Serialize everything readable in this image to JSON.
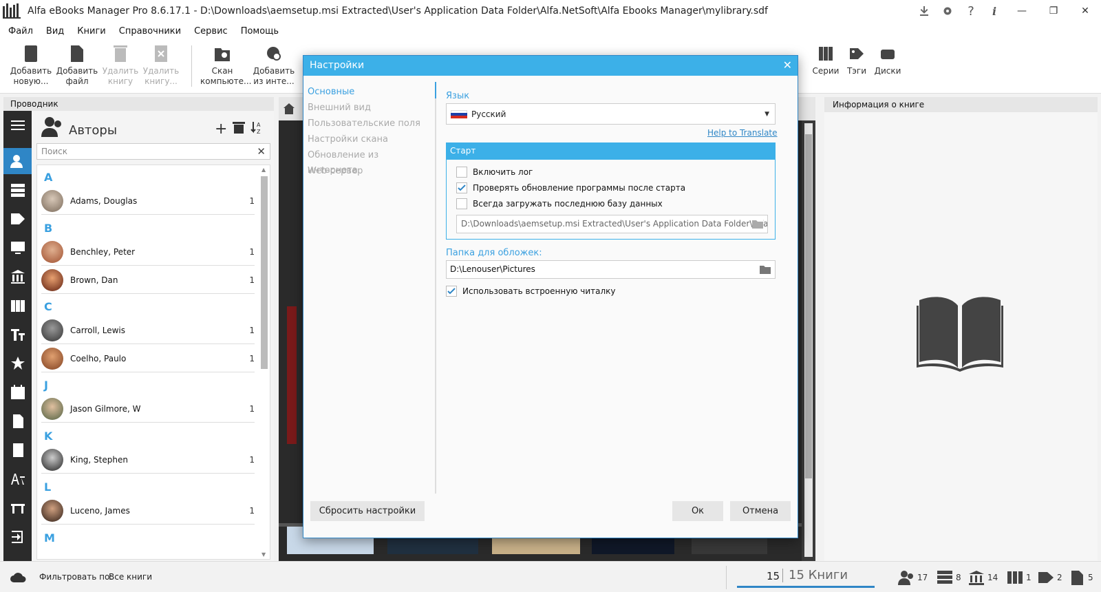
{
  "window": {
    "title": "Alfa eBooks Manager Pro 8.6.17.1 - D:\\Downloads\\aemsetup.msi Extracted\\User's Application Data Folder\\Alfa.NetSoft\\Alfa Ebooks Manager\\mylibrary.sdf"
  },
  "menu": [
    "Файл",
    "Вид",
    "Книги",
    "Справочники",
    "Сервис",
    "Помощь"
  ],
  "toolbar": {
    "add_new": "Добавить новую...",
    "add_file": "Добавить файл",
    "delete_book": "Удалить книгу",
    "delete_book2": "Удалить книгу...",
    "scan": "Скан компьюте...",
    "add_internet": "Добавить из инте...",
    "series": "Серии",
    "tags": "Тэги",
    "disks": "Диски"
  },
  "explorer": {
    "header": "Проводник",
    "title": "Авторы",
    "search_placeholder": "Поиск"
  },
  "authors": [
    {
      "letter": "A"
    },
    {
      "name": "Adams, Douglas",
      "count": "1"
    },
    {
      "letter": "B"
    },
    {
      "name": "Benchley, Peter",
      "count": "1"
    },
    {
      "name": "Brown, Dan",
      "count": "1"
    },
    {
      "letter": "C"
    },
    {
      "name": "Carroll, Lewis",
      "count": "1"
    },
    {
      "name": "Coelho, Paulo",
      "count": "1"
    },
    {
      "letter": "J"
    },
    {
      "name": "Jason Gilmore, W",
      "count": "1"
    },
    {
      "letter": "K"
    },
    {
      "name": "King, Stephen",
      "count": "1"
    },
    {
      "letter": "L"
    },
    {
      "name": "Luceno, James",
      "count": "1"
    },
    {
      "letter": "M"
    }
  ],
  "info": {
    "header": "Информация о книге"
  },
  "dialog": {
    "title": "Настройки",
    "nav": [
      "Основные",
      "Внешний вид",
      "Пользовательские поля",
      "Настройки скана",
      "Обновление из интернета",
      "Web-сервер"
    ],
    "language_label": "Язык",
    "language_value": "Русский",
    "help_link": "Help to Translate",
    "start_group": "Старт",
    "cb_log": "Включить лог",
    "cb_update": "Проверять обновление программы после старта",
    "cb_lastdb": "Всегда загружать последнюю базу данных",
    "db_path": "D:\\Downloads\\aemsetup.msi Extracted\\User's Application Data Folder\\Alfa.NetSoft\\Alfa Ebooks Manager\\mylibrary.sdf",
    "covers_label": "Папка для обложек:",
    "covers_value": "D:\\Lenouser\\Pictures",
    "cb_reader": "Использовать встроенную читалку",
    "reset_btn": "Сбросить настройки",
    "ok_btn": "Ок",
    "cancel_btn": "Отмена",
    "checked": {
      "log": false,
      "update": true,
      "lastdb": false,
      "reader": true
    }
  },
  "status": {
    "filter_label": "Фильтровать по:",
    "filter_value": "Все книги",
    "count": "15",
    "count_label": "15 Книги",
    "authors": "17",
    "shelves": "8",
    "publishers": "14",
    "series": "1",
    "tags": "2",
    "files": "5"
  },
  "colors": {
    "accent": "#3cb0e8",
    "sidebar": "#2b2b2b",
    "active": "#2f86c6"
  }
}
